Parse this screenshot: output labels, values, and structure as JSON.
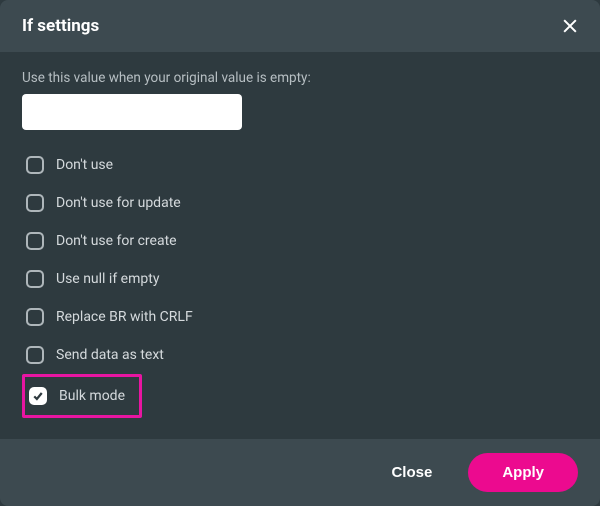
{
  "header": {
    "title": "If settings"
  },
  "body": {
    "defaultValueLabel": "Use this value when your original value is empty:",
    "defaultValueInput": ""
  },
  "options": [
    {
      "label": "Don't use",
      "checked": false
    },
    {
      "label": "Don't use for update",
      "checked": false
    },
    {
      "label": "Don't use for create",
      "checked": false
    },
    {
      "label": "Use null if empty",
      "checked": false
    },
    {
      "label": "Replace BR with CRLF",
      "checked": false
    },
    {
      "label": "Send data as text",
      "checked": false
    },
    {
      "label": "Bulk mode",
      "checked": true,
      "highlighted": true
    }
  ],
  "footer": {
    "closeLabel": "Close",
    "applyLabel": "Apply"
  },
  "colors": {
    "accent": "#ec0a8f",
    "highlight": "#e815a1",
    "panel": "#3d4a50",
    "background": "#2e3a3f"
  }
}
